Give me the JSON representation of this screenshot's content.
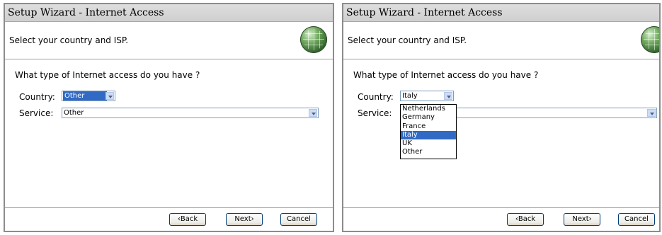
{
  "left": {
    "title": "Setup Wizard - Internet Access",
    "subtitle": "Select your country and ISP.",
    "question": "What type of Internet access do you have ?",
    "country_label": "Country:",
    "country_value": "Other",
    "service_label": "Service:",
    "service_value": "Other",
    "buttons": {
      "back": "‹Back",
      "next": "Next›",
      "cancel": "Cancel"
    }
  },
  "right": {
    "title": "Setup Wizard - Internet Access",
    "subtitle": "Select your country and ISP.",
    "question": "What type of Internet access do you have ?",
    "country_label": "Country:",
    "country_value": "Italy",
    "service_label": "Service:",
    "service_value": "",
    "dropdown_options": [
      "Netherlands",
      "Germany",
      "France",
      "Italy",
      "UK",
      "Other"
    ],
    "dropdown_selected": "Italy",
    "buttons": {
      "back": "‹Back",
      "next": "Next›",
      "cancel": "Cancel"
    }
  }
}
